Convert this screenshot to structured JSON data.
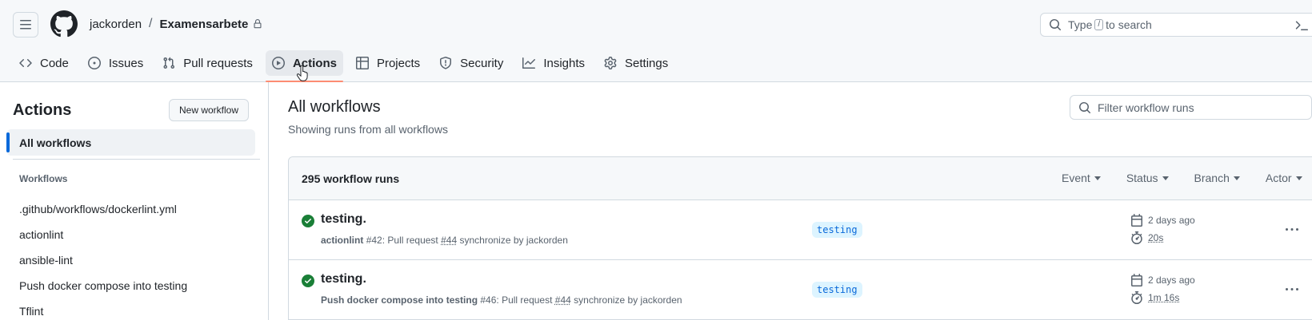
{
  "header": {
    "owner": "jackorden",
    "separator": "/",
    "repo": "Examensarbete",
    "search": {
      "prefix": "Type",
      "key": "/",
      "suffix": "to search"
    }
  },
  "nav": {
    "items": [
      {
        "label": "Code",
        "icon": "code-icon"
      },
      {
        "label": "Issues",
        "icon": "issue-icon"
      },
      {
        "label": "Pull requests",
        "icon": "pull-request-icon"
      },
      {
        "label": "Actions",
        "icon": "play-icon",
        "selected": true
      },
      {
        "label": "Projects",
        "icon": "table-icon"
      },
      {
        "label": "Security",
        "icon": "shield-icon"
      },
      {
        "label": "Insights",
        "icon": "graph-icon"
      },
      {
        "label": "Settings",
        "icon": "gear-icon"
      }
    ]
  },
  "sidebar": {
    "title": "Actions",
    "new_workflow": "New workflow",
    "all_workflows": "All workflows",
    "workflows_heading": "Workflows",
    "workflows": [
      ".github/workflows/dockerlint.yml",
      "actionlint",
      "ansible-lint",
      "Push docker compose into testing",
      "Tflint"
    ]
  },
  "main": {
    "title": "All workflows",
    "subtitle": "Showing runs from all workflows",
    "filter_placeholder": "Filter workflow runs",
    "runs_count": "295 workflow runs",
    "filters": [
      "Event",
      "Status",
      "Branch",
      "Actor"
    ],
    "runs": [
      {
        "title": "testing.",
        "workflow": "actionlint",
        "run_no": "#42",
        "trigger": ": Pull request",
        "pr": "#44",
        "action": "synchronize by jackorden",
        "branch": "testing",
        "date": "2 days ago",
        "duration": "20s",
        "status": "success"
      },
      {
        "title": "testing.",
        "workflow": "Push docker compose into testing",
        "run_no": "#46",
        "trigger": ": Pull request",
        "pr": "#44",
        "action": "synchronize by jackorden",
        "branch": "testing",
        "date": "2 days ago",
        "duration": "1m 16s",
        "status": "success"
      }
    ]
  },
  "colors": {
    "accent_blue": "#0969da",
    "success_green": "#1a7f37",
    "nav_underline": "#fd8c73",
    "border": "#d1d9e0"
  }
}
